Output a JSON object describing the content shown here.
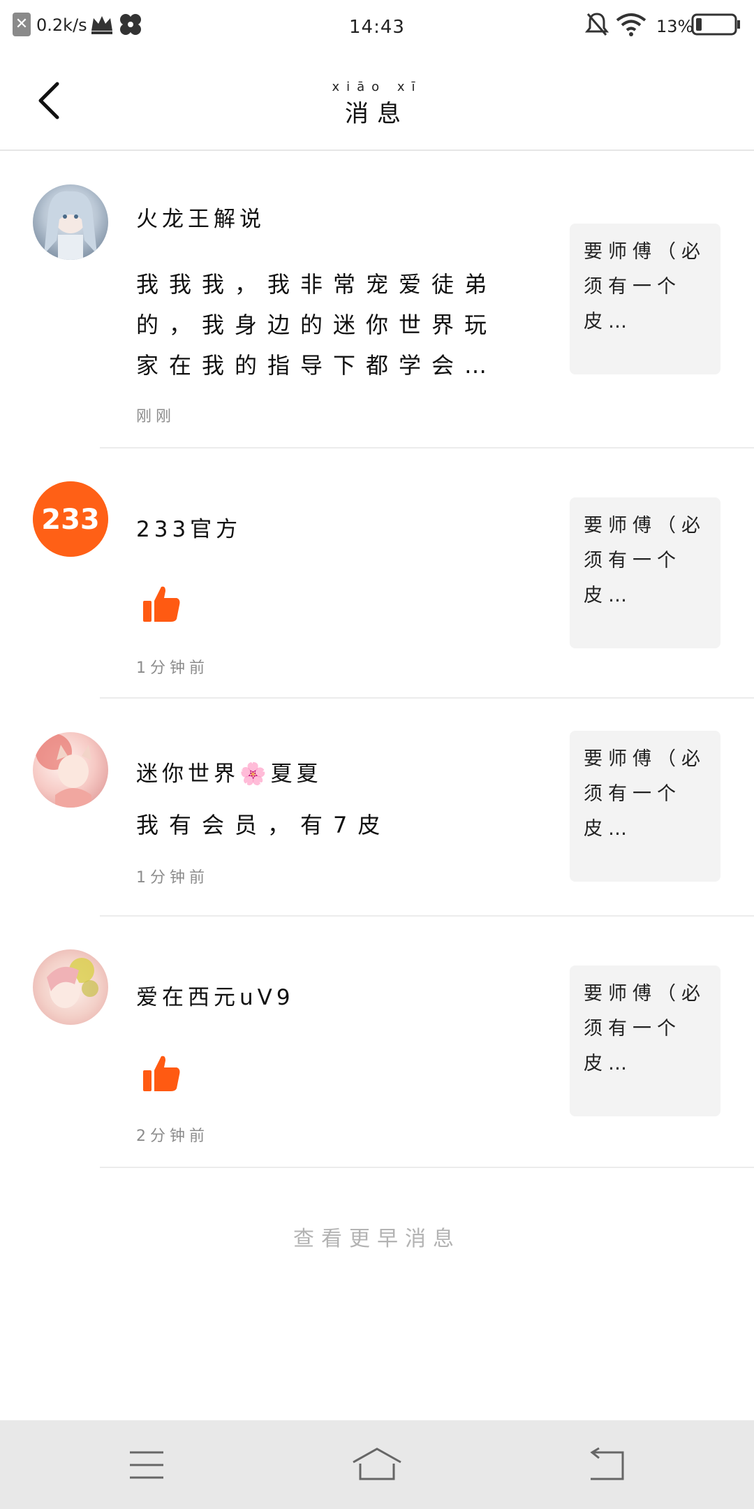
{
  "status_bar": {
    "speed": "0.2k/s",
    "time": "14:43",
    "battery": "13%"
  },
  "header": {
    "title_pinyin": "xiāo xī",
    "title": "消息"
  },
  "messages": [
    {
      "name": "火龙王解说",
      "body": "我我我，我非常宠爱徒弟的，我身边的迷你世界玩家在我的指导下都学会…",
      "time": "刚刚",
      "preview": "要师傅（必须有一个皮…"
    },
    {
      "name": "233官方",
      "time": "1分钟前",
      "preview": "要师傅（必须有一个皮…"
    },
    {
      "name": "迷你世界🌸夏夏",
      "body": "我有会员，有7皮",
      "time": "1分钟前",
      "preview": "要师傅（必须有一个皮…"
    },
    {
      "name": "爱在西元uV9",
      "time": "2分钟前",
      "preview": "要师傅（必须有一个皮…"
    }
  ],
  "footer": {
    "more_label": "查看更早消息"
  },
  "colors": {
    "accent_orange": "#FF5A12",
    "divider": "#ECECEC",
    "preview_bg": "#F3F3F3",
    "navbar_bg": "#E8E8E8"
  }
}
